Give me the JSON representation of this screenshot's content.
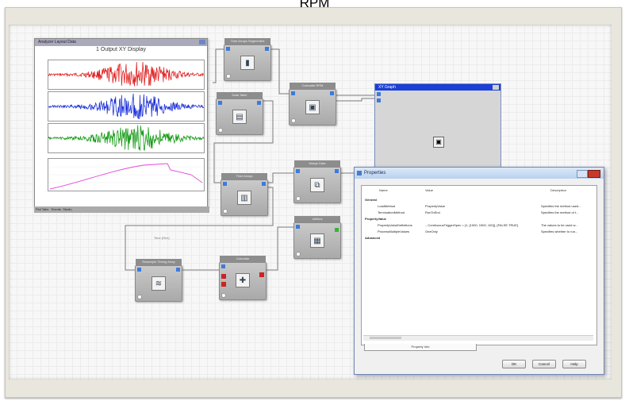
{
  "caption": "RPM",
  "xy_window": {
    "title": "Analyzer Layout Data",
    "display_title": "1 Output XY Display",
    "x_axis_label": "Time (Rev)",
    "footer": "Plot Tabs",
    "footer_btn1": "Events",
    "footer_btn2": "Studio"
  },
  "nodes": {
    "n1": "Time Arrays Segmented",
    "n2": "Data Table",
    "n3": "Calculate RPM",
    "n4": "Time Arrays",
    "n5": "Merge Data",
    "n6": "Resample Timing Array",
    "n7": "Calculate",
    "n8": "Utilities"
  },
  "graph_window": {
    "title": "XY Graph"
  },
  "properties": {
    "title": "Properties",
    "columns": {
      "name": "Name",
      "value": "Value",
      "description": "Description"
    },
    "rows": [
      {
        "kind": "category",
        "name": "General"
      },
      {
        "kind": "prop",
        "name": "LoadMethod",
        "value": "PropertyValue",
        "desc": "Specifies the method used..."
      },
      {
        "kind": "prop",
        "name": "TerminationMethod",
        "value": "RunToEnd",
        "desc": "Specifies the method of t..."
      },
      {
        "kind": "category",
        "name": "PropertyValue"
      },
      {
        "kind": "prop",
        "name": "PropertyValueDefinitions",
        "value": "...ContinuousTriggerSpec = {1, [1000, 1500, 100]}, {FALSE TRUE}",
        "desc": "The values to be used w..."
      },
      {
        "kind": "prop",
        "name": "ProcessMultipleValues",
        "value": "OneOnly",
        "desc": "Specifies whether to run..."
      },
      {
        "kind": "category",
        "name": "Advanced"
      }
    ],
    "tab": "Property Info",
    "buttons": {
      "ok": "OK",
      "cancel": "Cancel",
      "help": "Help"
    }
  },
  "colors": {
    "wave_red": "#e02020",
    "wave_blue": "#1a2fd8",
    "wave_green": "#139a13",
    "curve_magenta": "#e04ad8",
    "port_blue": "#3d7bdc",
    "title_blue": "#1c3fd6"
  }
}
